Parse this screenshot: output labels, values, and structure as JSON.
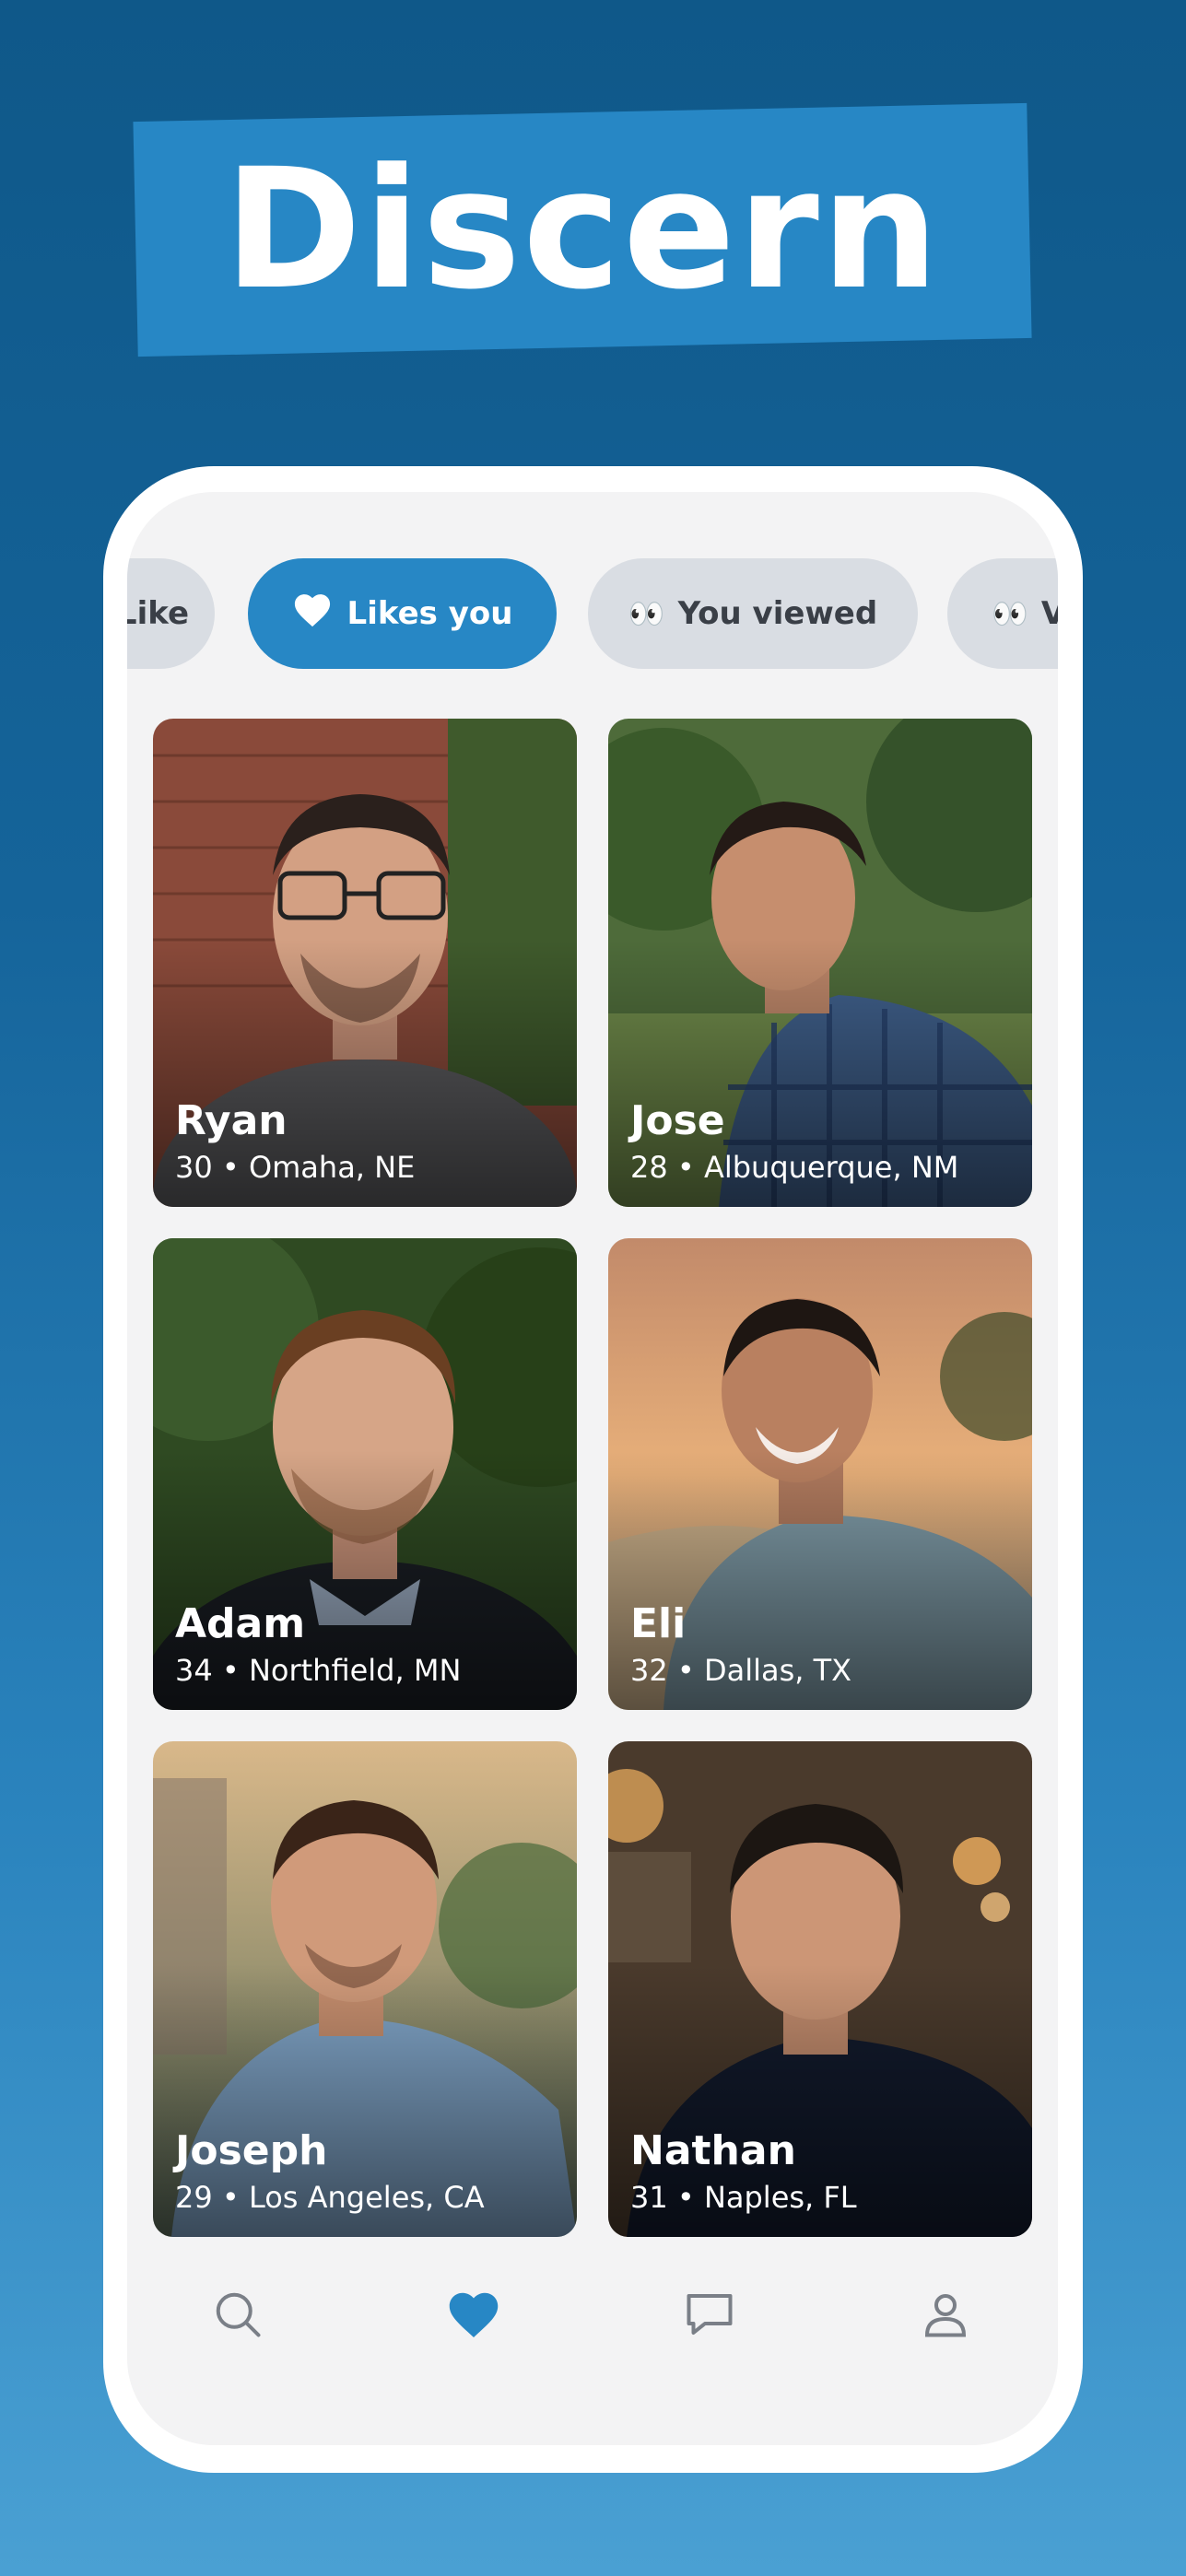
{
  "app": {
    "title": "Discern"
  },
  "tabs": [
    {
      "label": "Like"
    },
    {
      "label": "Likes you"
    },
    {
      "label": "You viewed"
    },
    {
      "label": "Viewed you"
    }
  ],
  "profiles": [
    {
      "name": "Ryan",
      "meta": "30 • Omaha, NE"
    },
    {
      "name": "Jose",
      "meta": "28 • Albuquerque, NM"
    },
    {
      "name": "Adam",
      "meta": "34 • Northfield, MN"
    },
    {
      "name": "Eli",
      "meta": "32 • Dallas, TX"
    },
    {
      "name": "Joseph",
      "meta": "29 • Los Angeles, CA"
    },
    {
      "name": "Nathan",
      "meta": "31 • Naples, FL"
    }
  ],
  "nav": [
    {
      "icon": "search-icon"
    },
    {
      "icon": "heart-icon"
    },
    {
      "icon": "chat-icon"
    },
    {
      "icon": "profile-icon"
    }
  ],
  "colors": {
    "accent": "#2787c5",
    "background_top": "#0f5889",
    "background_bottom": "#4aa0d3"
  }
}
